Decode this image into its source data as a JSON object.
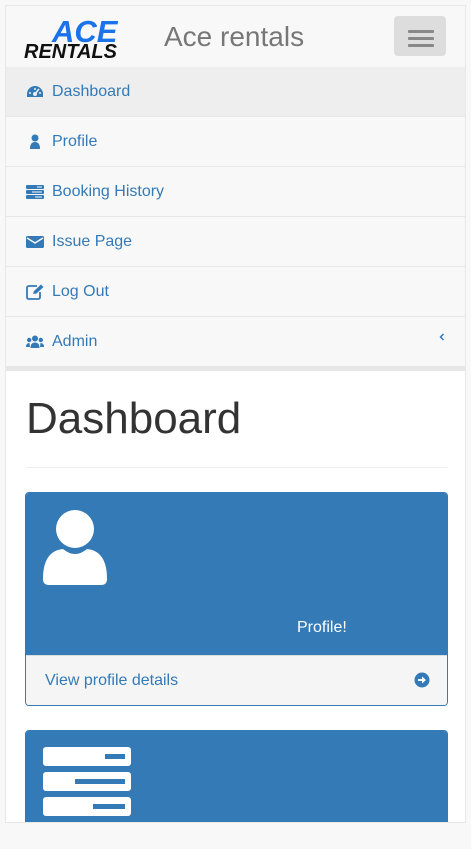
{
  "brand": {
    "logo_top": "ACE",
    "logo_bottom": "RENTALS",
    "title": "Ace rentals"
  },
  "navbar": {
    "toggle_icon": "hamburger-icon"
  },
  "sidebar": {
    "items": [
      {
        "label": "Dashboard",
        "icon": "dashboard-icon",
        "active": true
      },
      {
        "label": "Profile",
        "icon": "user-icon"
      },
      {
        "label": "Booking History",
        "icon": "tasks-icon"
      },
      {
        "label": "Issue Page",
        "icon": "envelope-icon"
      },
      {
        "label": "Log Out",
        "icon": "edit-icon"
      },
      {
        "label": "Admin",
        "icon": "users-icon",
        "expand_icon": "chevron-left-icon"
      }
    ]
  },
  "main": {
    "title": "Dashboard",
    "panels": [
      {
        "caption": "Profile!",
        "icon": "user-icon",
        "footer_link": "View profile details",
        "footer_icon": "arrow-circle-right-icon"
      },
      {
        "icon": "tasks-icon"
      }
    ]
  },
  "colors": {
    "primary": "#337ab7",
    "navbar_bg": "#f8f8f8",
    "brand_text": "#777777",
    "logo_blue": "#1a73e8"
  }
}
